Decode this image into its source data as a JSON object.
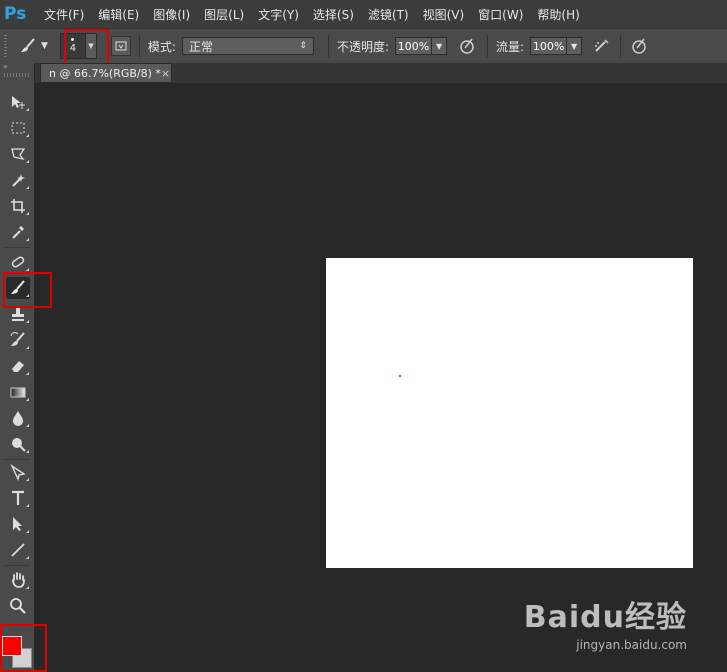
{
  "app": {
    "logo": "Ps"
  },
  "menu": [
    "文件(F)",
    "编辑(E)",
    "图像(I)",
    "图层(L)",
    "文字(Y)",
    "选择(S)",
    "滤镜(T)",
    "视图(V)",
    "窗口(W)",
    "帮助(H)"
  ],
  "options": {
    "brush_size": "4",
    "mode_label": "模式:",
    "mode_value": "正常",
    "opacity_label": "不透明度:",
    "opacity_value": "100%",
    "flow_label": "流量:",
    "flow_value": "100%"
  },
  "document": {
    "tab_title": "n @ 66.7%(RGB/8) *",
    "close_glyph": "×"
  },
  "colors": {
    "foreground": "#ff0000",
    "background": "#d2d2d2",
    "highlight": "#e00000"
  },
  "watermark": {
    "main": "Baidu经验",
    "sub": "jingyan.baidu.com"
  }
}
